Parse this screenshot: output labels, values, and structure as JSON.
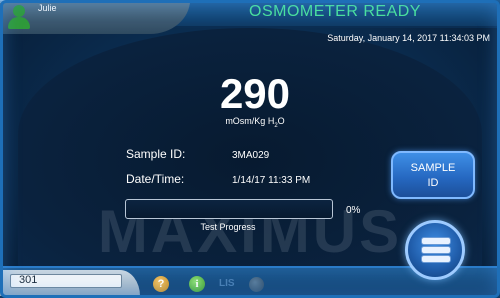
{
  "header": {
    "user_name": "Julie",
    "status_title": "OSMOMETER READY",
    "datetime": "Saturday, January 14, 2017 11:34:03 PM"
  },
  "result": {
    "value": "290",
    "units": "mOsm/Kg H",
    "units_subscript": "2",
    "units_suffix": "O"
  },
  "fields": {
    "sample_id_label": "Sample ID:",
    "sample_id_value": "3MA029",
    "datetime_label": "Date/Time:",
    "datetime_value": "1/14/17 11:33 PM"
  },
  "progress": {
    "percent_text": "0%",
    "fraction": 0.0,
    "label": "Test Progress"
  },
  "buttons": {
    "sample_id_line1": "SAMPLE",
    "sample_id_line2": "ID"
  },
  "watermark": "MAXIMUS",
  "footer": {
    "counter_value": "301",
    "help_symbol": "?",
    "info_symbol": "i",
    "lis_label": "LIS"
  },
  "colors": {
    "status_title": "#4be39b",
    "accent_blue": "#3f8fe6",
    "user_icon": "#2f9a3a"
  },
  "icons": {
    "user": "user-icon",
    "help": "help-icon",
    "info": "info-icon",
    "menu": "menu-icon",
    "lis": "lis-status-icon"
  }
}
